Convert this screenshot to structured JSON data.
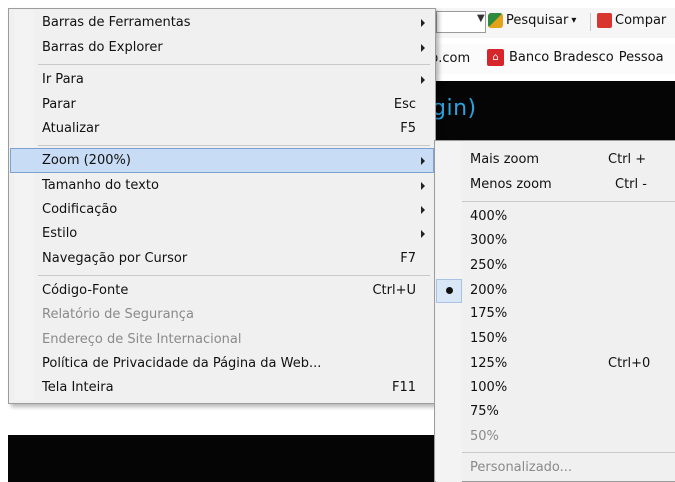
{
  "browser": {
    "search_label": "Pesquisar",
    "search_arrow": "▾",
    "compare_label": "Compar",
    "fav_fragment": "b.com",
    "fav_bradesco_label": "Banco Bradesco",
    "fav_pessoa_label": "Pessoa",
    "page_text": "gin)"
  },
  "menu": {
    "items": [
      {
        "label": "Barras de Ferramentas"
      },
      {
        "label": "Barras do Explorer"
      },
      {
        "label": "Ir Para"
      },
      {
        "label": "Parar",
        "shortcut": "Esc"
      },
      {
        "label": "Atualizar",
        "shortcut": "F5"
      },
      {
        "label": "Zoom (200%)"
      },
      {
        "label": "Tamanho do texto"
      },
      {
        "label": "Codificação"
      },
      {
        "label": "Estilo"
      },
      {
        "label": "Navegação por Cursor",
        "shortcut": "F7"
      },
      {
        "label": "Código-Fonte",
        "shortcut": "Ctrl+U"
      },
      {
        "label": "Relatório de Segurança"
      },
      {
        "label": "Endereço de Site Internacional"
      },
      {
        "label": "Política de Privacidade da Página da Web..."
      },
      {
        "label": "Tela Inteira",
        "shortcut": "F11"
      }
    ]
  },
  "zoom_submenu": {
    "items": [
      {
        "label": "Mais zoom",
        "shortcut": "Ctrl +"
      },
      {
        "label": "Menos zoom",
        "shortcut": "Ctrl -"
      },
      {
        "label": "400%"
      },
      {
        "label": "300%"
      },
      {
        "label": "250%"
      },
      {
        "label": "200%"
      },
      {
        "label": "175%"
      },
      {
        "label": "150%"
      },
      {
        "label": "125%",
        "shortcut": "Ctrl+0"
      },
      {
        "label": "100%"
      },
      {
        "label": "75%"
      },
      {
        "label": "50%"
      },
      {
        "label": "Personalizado..."
      }
    ],
    "selected_value": "200%"
  },
  "colors": {
    "highlight_fill": "#c9dcf5",
    "highlight_border": "#7da2ce",
    "disabled_text": "#8a8a8a",
    "page_link_blue": "#2aa3e0"
  }
}
